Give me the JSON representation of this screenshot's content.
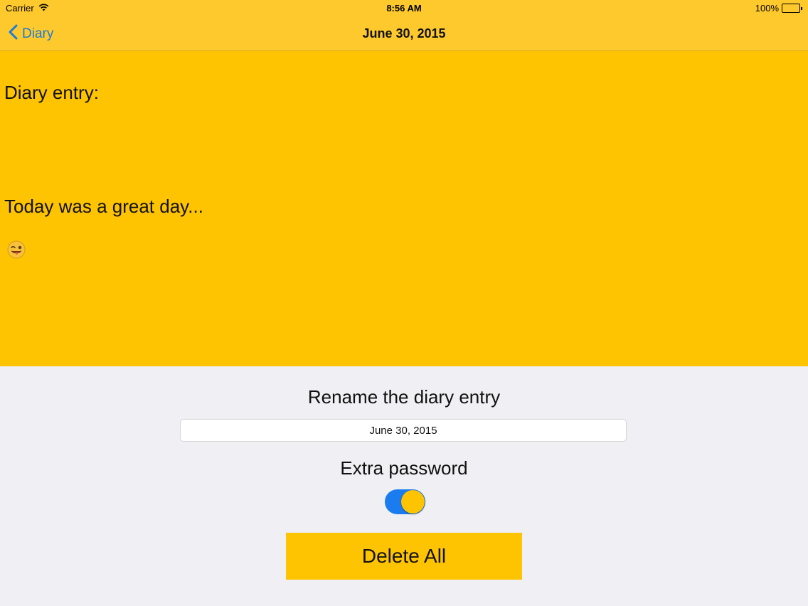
{
  "status_bar": {
    "carrier": "Carrier",
    "time": "8:56 AM",
    "battery": "100%",
    "battery_level": 1.0
  },
  "nav_bar": {
    "back_label": "Diary",
    "title": "June 30, 2015"
  },
  "entry": {
    "heading": "Diary entry:",
    "body": "Today was a great day...",
    "emoji": "😜"
  },
  "panel": {
    "rename_label": "Rename the diary entry",
    "rename_value": "June 30, 2015",
    "password_label": "Extra password",
    "password_toggle_on": true,
    "delete_label": "Delete All"
  },
  "colors": {
    "bar": "#fec92c",
    "accent": "#fec401",
    "link_blue": "#1d7ad8",
    "toggle_on": "#1b7cf0",
    "panel_bg": "#efeff4"
  },
  "icons": {
    "wifi": "wifi-icon",
    "battery": "battery-icon",
    "back": "chevron-left-icon"
  }
}
